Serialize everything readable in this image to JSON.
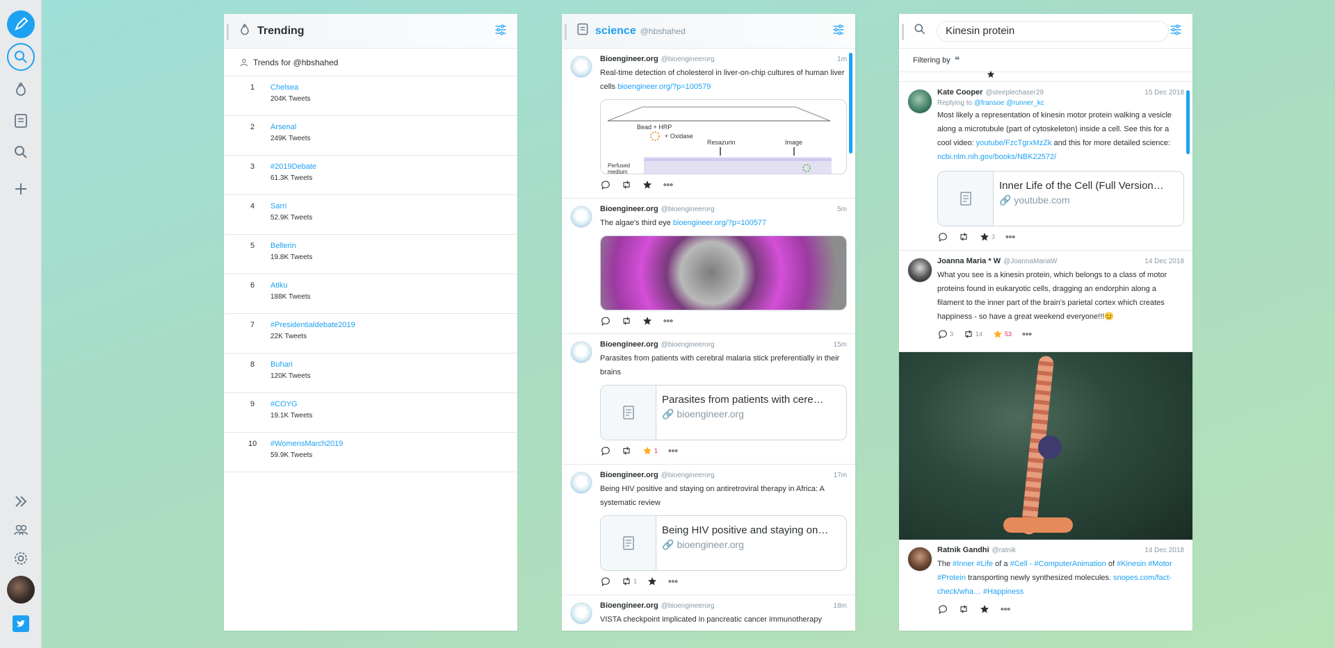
{
  "sidebar": {
    "items": [
      "compose-icon",
      "search-icon",
      "trending-icon",
      "list-icon",
      "search-icon-2",
      "add-column-icon"
    ],
    "bottom": [
      "expand-icon",
      "accounts-icon",
      "settings-icon",
      "avatar",
      "twitter-logo"
    ]
  },
  "trending": {
    "col_num": "1",
    "title": "Trending",
    "trends_for": "Trends for @hbshahed",
    "items": [
      {
        "rank": "1",
        "name": "Chelsea",
        "count": "204K Tweets"
      },
      {
        "rank": "2",
        "name": "Arsenal",
        "count": "249K Tweets"
      },
      {
        "rank": "3",
        "name": "#2019Debate",
        "count": "61.3K Tweets"
      },
      {
        "rank": "4",
        "name": "Sarri",
        "count": "52.9K Tweets"
      },
      {
        "rank": "5",
        "name": "Bellerin",
        "count": "19.8K Tweets"
      },
      {
        "rank": "6",
        "name": "Atiku",
        "count": "188K Tweets"
      },
      {
        "rank": "7",
        "name": "#Presidentialdebate2019",
        "count": "22K Tweets"
      },
      {
        "rank": "8",
        "name": "Buhari",
        "count": "120K Tweets"
      },
      {
        "rank": "9",
        "name": "#COYG",
        "count": "19.1K Tweets"
      },
      {
        "rank": "10",
        "name": "#WomensMarch2019",
        "count": "59.9K Tweets"
      }
    ]
  },
  "science": {
    "col_num": "2",
    "title": "science",
    "handle": "@hbshahed",
    "tweets": [
      {
        "name": "Bioengineer.org",
        "handle": "@bioengineerorg",
        "time": "1m",
        "text": "Real-time detection of cholesterol in liver-on-chip cultures of human liver cells ",
        "link": "bioengineer.org/?p=100579",
        "diagram": {
          "l1": "Bead + HRP",
          "l2": "+ Oxidase",
          "l3": "Resazurin",
          "l4": "Image",
          "l5": "Perfused",
          "l6": "medium"
        }
      },
      {
        "name": "Bioengineer.org",
        "handle": "@bioengineerorg",
        "time": "5m",
        "text": "The algae's third eye ",
        "link": "bioengineer.org/?p=100577"
      },
      {
        "name": "Bioengineer.org",
        "handle": "@bioengineerorg",
        "time": "15m",
        "text": "Parasites from patients with cerebral malaria stick preferentially in their brains",
        "card_title": "Parasites from patients with cerebral malaria stick preferentially in their brains",
        "card_domain": "bioengineer.org",
        "likes": "1"
      },
      {
        "name": "Bioengineer.org",
        "handle": "@bioengineerorg",
        "time": "17m",
        "text": "Being HIV positive and staying on antiretroviral therapy in Africa: A systematic review",
        "card_title": "Being HIV positive and staying on antiretroviral therapy",
        "card_domain": "bioengineer.org",
        "retweets": "1"
      },
      {
        "name": "Bioengineer.org",
        "handle": "@bioengineerorg",
        "time": "18m",
        "text": "VISTA checkpoint implicated in pancreatic cancer immunotherapy"
      }
    ]
  },
  "search": {
    "col_num": "3",
    "query": "Kinesin protein",
    "filtering": "Filtering by",
    "tweets": [
      {
        "name": "Kate Cooper",
        "handle": "@steeplechaser29",
        "time": "15 Dec 2018",
        "reply_prefix": "Replying to ",
        "reply_to": "@fransoe @runner_kc",
        "text_a": "Most likely a representation of kinesin motor protein walking a vesicle along a microtubule (part of cytoskeleton) inside a cell. See this for a cool video: ",
        "link_a": "youtube/FzcTgrxMzZk",
        "text_b": " and this for more detailed science: ",
        "link_b": "ncbi.nlm.nih.gov/books/NBK22572/",
        "card_title": "Inner Life of the Cell (Full Version - Narrated)",
        "card_domain": "youtube.com",
        "likes": "3"
      },
      {
        "name": "Joanna Maria * W",
        "handle": "@JoannaMariaW",
        "time": "14 Dec 2018",
        "text": "What you see is a kinesin protein, which belongs to a class of motor proteins found in eukaryotic cells,  dragging an endorphin along a filament to the inner part of the brain's parietal cortex which creates happiness - so have a great weekend everyone!!!😊",
        "replies": "3",
        "retweets": "14",
        "likes": "53"
      },
      {
        "name": "Ratnik Gandhi",
        "handle": "@ratnik",
        "time": "14 Dec 2018",
        "text_a": "The ",
        "tags_a": "#Inner #Life",
        "text_b": " of a ",
        "tags_b": "#Cell - #ComputerAnimation",
        "text_c": " of ",
        "tags_c": "#Kinesin #Motor #Protein",
        "text_d": "  transporting newly synthesized molecules. ",
        "link": "snopes.com/fact-check/wha…",
        "tags_d": "  #Happiness"
      }
    ]
  },
  "colors": {
    "accent": "#1da1f2",
    "like": "#ffad1f"
  }
}
